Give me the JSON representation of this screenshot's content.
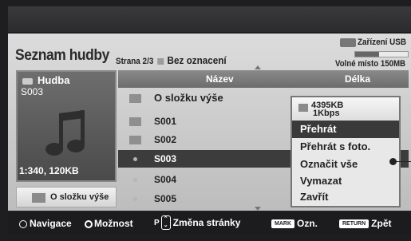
{
  "screen": {
    "title": "Seznam hudby",
    "page_label": "Strana 2/3",
    "mark_status": "Bez oznacení",
    "device": "Zařízení USB",
    "storage_used_fraction": 0.45,
    "free_space": "Volné místo 150MB"
  },
  "preview": {
    "category": "Hudba",
    "selected_file": "S003",
    "meta": "1:340, 120KB",
    "folder_up_button": "O složku výše"
  },
  "table": {
    "col_name": "Název",
    "col_length": "Délka",
    "rows": [
      {
        "name": "O složku výše",
        "type": "folder-up"
      },
      {
        "name": "S001",
        "type": "folder"
      },
      {
        "name": "S002",
        "type": "folder"
      },
      {
        "name": "S003",
        "type": "file",
        "active": true
      },
      {
        "name": "S004",
        "type": "file"
      },
      {
        "name": "S005",
        "type": "file"
      }
    ]
  },
  "context_menu": {
    "size": "4395KB",
    "bitrate": "1Kbps",
    "items": [
      "Přehrát",
      "Přehrát s foto.",
      "Označit vše",
      "Vymazat",
      "Zavřít"
    ],
    "selected_index": 0
  },
  "footer": {
    "navigation": "Navigace",
    "option": "Možnost",
    "p_label": "P",
    "page_change": "Změna stránky",
    "mark_btn": "MARK",
    "mark": "Ozn.",
    "return_btn": "RETURN",
    "back": "Zpět"
  }
}
